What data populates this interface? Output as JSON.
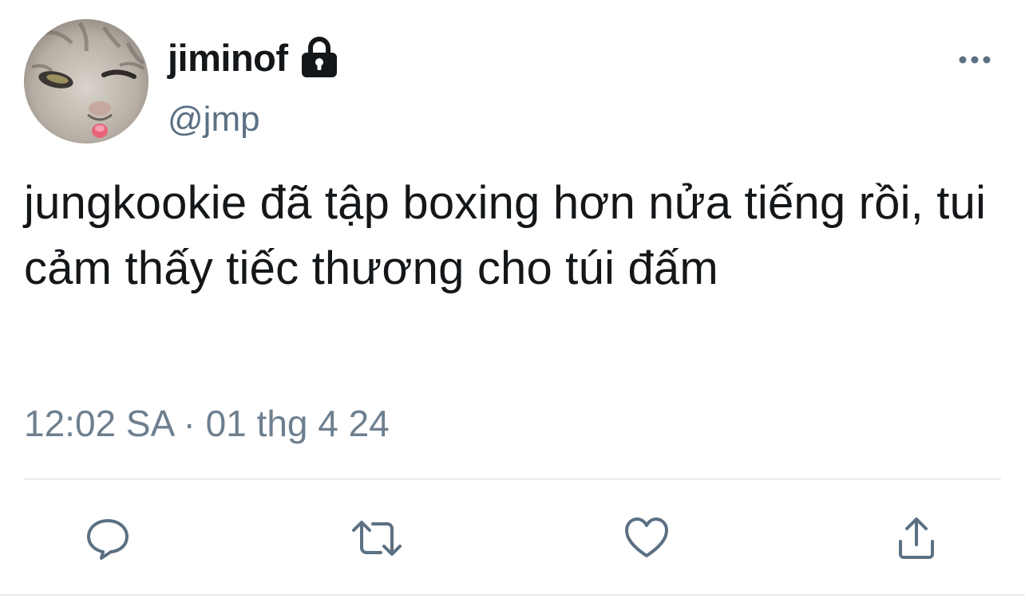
{
  "tweet": {
    "display_name": "jiminof",
    "protected_icon": "lock-icon",
    "handle": "@jmp",
    "text": "jungkookie đã tập boxing hơn nửa tiếng rồi, tui cảm thấy tiếc thương cho túi đấm",
    "timestamp": "12:02 SA · 01 thg 4 24"
  },
  "icons": {
    "more": "more-horizontal-icon",
    "reply": "reply-icon",
    "retweet": "retweet-icon",
    "like": "heart-icon",
    "share": "share-icon"
  },
  "colors": {
    "text_primary": "#14171a",
    "text_secondary": "#5b7083",
    "icon": "#5b7083",
    "divider": "#e6ecf0"
  }
}
